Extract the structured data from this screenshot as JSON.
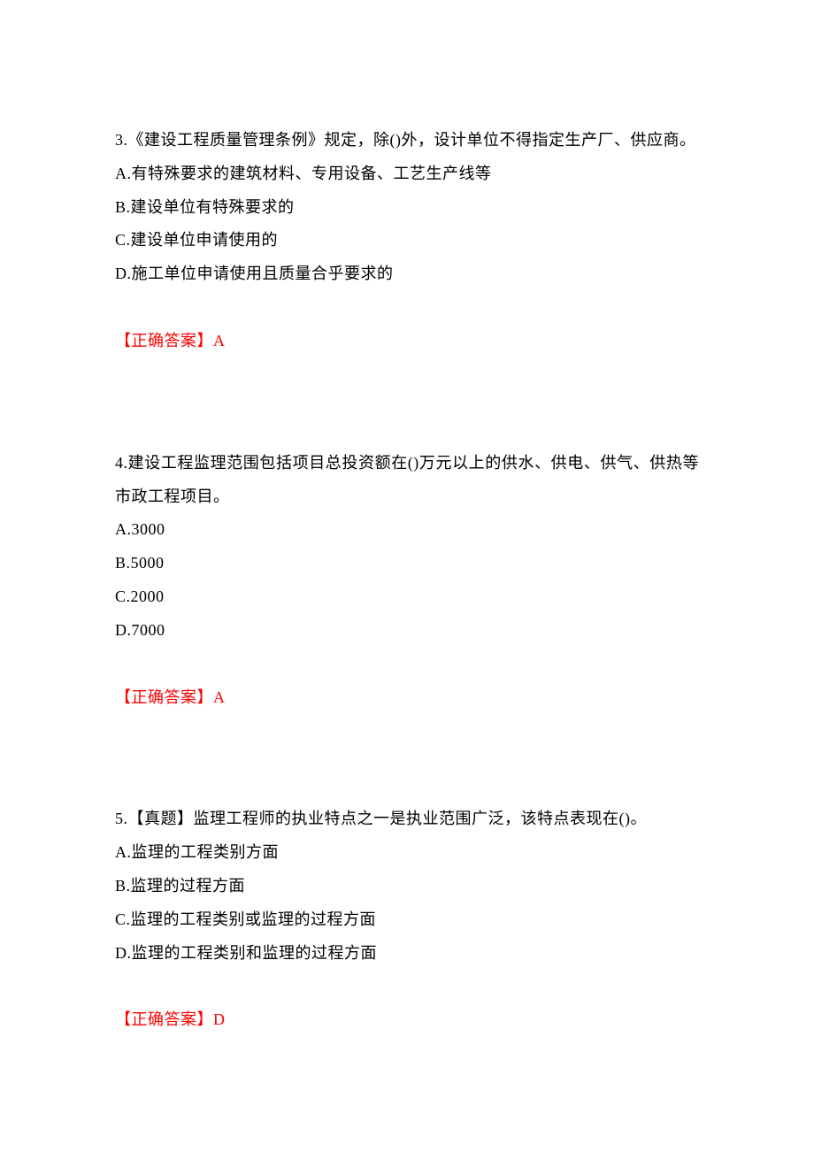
{
  "questions": [
    {
      "number": "3.",
      "text": "《建设工程质量管理条例》规定，除()外，设计单位不得指定生产厂、供应商。",
      "options": {
        "A": "A.有特殊要求的建筑材料、专用设备、工艺生产线等",
        "B": "B.建设单位有特殊要求的",
        "C": "C.建设单位申请使用的",
        "D": "D.施工单位申请使用且质量合乎要求的"
      },
      "answer_label": "【正确答案】",
      "answer_value": "A"
    },
    {
      "number": "4.",
      "text": "建设工程监理范围包括项目总投资额在()万元以上的供水、供电、供气、供热等市政工程项目。",
      "options": {
        "A": "A.3000",
        "B": "B.5000",
        "C": "C.2000",
        "D": "D.7000"
      },
      "answer_label": "【正确答案】",
      "answer_value": "A"
    },
    {
      "number": "5.",
      "text": "【真题】监理工程师的执业特点之一是执业范围广泛，该特点表现在()。",
      "options": {
        "A": "A.监理的工程类别方面",
        "B": "B.监理的过程方面",
        "C": "C.监理的工程类别或监理的过程方面",
        "D": "D.监理的工程类别和监理的过程方面"
      },
      "answer_label": "【正确答案】",
      "answer_value": "D"
    }
  ]
}
